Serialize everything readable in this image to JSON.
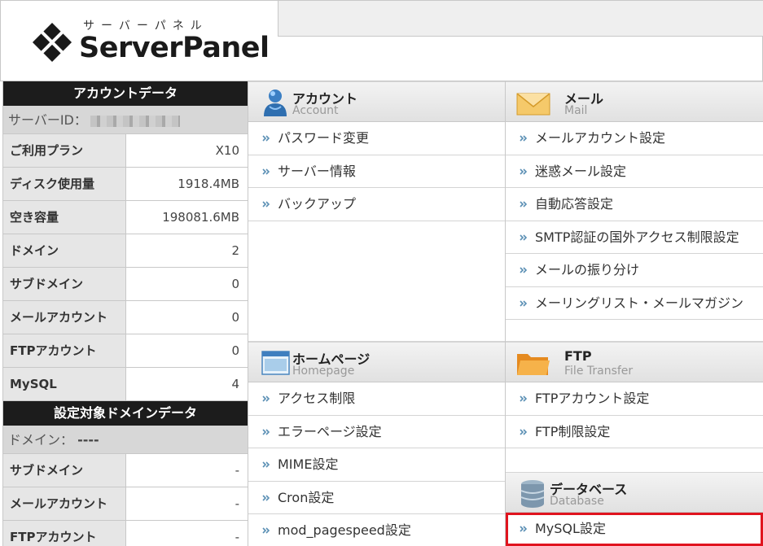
{
  "header": {
    "logo_kana": "サーバーパネル",
    "logo_text": "ServerPanel"
  },
  "sidebar": {
    "account_title": "アカウントデータ",
    "server_id_label": "サーバーID：",
    "account_rows": [
      {
        "label": "ご利用プラン",
        "value": "X10"
      },
      {
        "label": "ディスク使用量",
        "value": "1918.4MB"
      },
      {
        "label": "空き容量",
        "value": "198081.6MB"
      },
      {
        "label": "ドメイン",
        "value": "2"
      },
      {
        "label": "サブドメイン",
        "value": "0"
      },
      {
        "label": "メールアカウント",
        "value": "0"
      },
      {
        "label": "FTPアカウント",
        "value": "0"
      },
      {
        "label": "MySQL",
        "value": "4"
      }
    ],
    "domain_title": "設定対象ドメインデータ",
    "domain_label": "ドメイン：",
    "domain_value": "----",
    "domain_rows": [
      {
        "label": "サブドメイン",
        "value": "-"
      },
      {
        "label": "メールアカウント",
        "value": "-"
      },
      {
        "label": "FTPアカウント",
        "value": "-"
      }
    ]
  },
  "panels": {
    "account": {
      "title": "アカウント",
      "subtitle": "Account",
      "icon": "user-icon",
      "items": [
        "パスワード変更",
        "サーバー情報",
        "バックアップ"
      ]
    },
    "mail": {
      "title": "メール",
      "subtitle": "Mail",
      "icon": "envelope-icon",
      "items": [
        "メールアカウント設定",
        "迷惑メール設定",
        "自動応答設定",
        "SMTP認証の国外アクセス制限設定",
        "メールの振り分け",
        "メーリングリスト・メールマガジン"
      ]
    },
    "homepage": {
      "title": "ホームページ",
      "subtitle": "Homepage",
      "icon": "browser-window-icon",
      "items": [
        "アクセス制限",
        "エラーページ設定",
        "MIME設定",
        "Cron設定",
        "mod_pagespeed設定"
      ]
    },
    "ftp": {
      "title": "FTP",
      "subtitle": "File Transfer",
      "icon": "folder-icon",
      "items": [
        "FTPアカウント設定",
        "FTP制限設定"
      ]
    },
    "database": {
      "title": "データベース",
      "subtitle": "Database",
      "icon": "database-icon",
      "items": [
        "MySQL設定"
      ]
    }
  },
  "colors": {
    "highlight": "#e0141e",
    "sidebar_title_bg": "#1c1c1c",
    "arrow": "#5a8fb4"
  }
}
